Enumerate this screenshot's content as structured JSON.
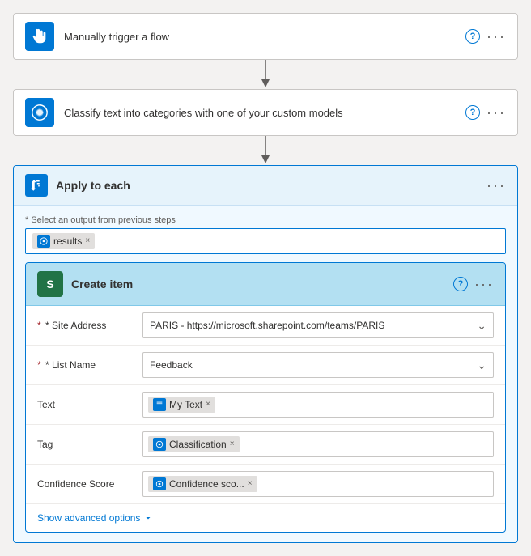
{
  "cards": {
    "trigger": {
      "title": "Manually trigger a flow",
      "icon": "hand-icon"
    },
    "classify": {
      "title": "Classify text into categories with one of your custom models",
      "icon": "classify-icon"
    },
    "applyEach": {
      "title": "Apply to each",
      "selectLabel": "* Select an output from previous steps",
      "outputToken": "results"
    },
    "createItem": {
      "title": "Create item",
      "fields": {
        "siteAddress": {
          "label": "* Site Address",
          "value": "PARIS - https://microsoft.sharepoint.com/teams/PARIS"
        },
        "listName": {
          "label": "* List Name",
          "value": "Feedback"
        },
        "text": {
          "label": "Text",
          "token": "My Text"
        },
        "tag": {
          "label": "Tag",
          "token": "Classification"
        },
        "confidenceScore": {
          "label": "Confidence Score",
          "token": "Confidence sco..."
        }
      },
      "advancedOptions": "Show advanced options"
    }
  },
  "buttons": {
    "help": "?",
    "more": "···"
  }
}
